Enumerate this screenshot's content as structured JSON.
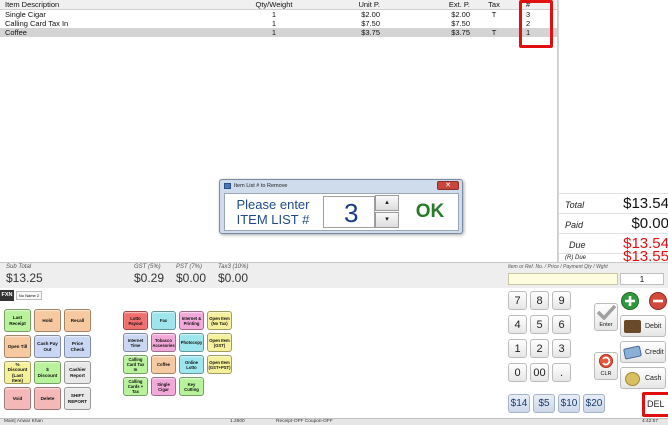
{
  "items_table": {
    "headers": {
      "description": "Item Description",
      "qty": "Qty/Weight",
      "unit_price": "Unit P.",
      "ext_price": "Ext. P.",
      "tax": "Tax",
      "list_num": "#"
    },
    "rows": [
      {
        "description": "Single Cigar",
        "qty": "1",
        "unit_price": "$2.00",
        "ext_price": "$2.00",
        "tax": "T",
        "list_num": "3"
      },
      {
        "description": "Calling Card Tax In",
        "qty": "1",
        "unit_price": "$7.50",
        "ext_price": "$7.50",
        "tax": "",
        "list_num": "2"
      },
      {
        "description": "Coffee",
        "qty": "1",
        "unit_price": "$3.75",
        "ext_price": "$3.75",
        "tax": "T",
        "list_num": "1"
      }
    ]
  },
  "totals": {
    "total_label": "Total",
    "total_value": "$13.54",
    "paid_label": "Paid",
    "paid_value": "$0.00",
    "due_label": "Due",
    "due_value": "$13.54",
    "rdue_label": "(R) Due",
    "rdue_value": "$13.55"
  },
  "dialog": {
    "title": "Item List # to Remove",
    "prompt_line1": "Please enter",
    "prompt_line2": "ITEM LIST #",
    "value": "3",
    "up_icon": "up-arrow",
    "down_icon": "down-arrow",
    "ok_label": "OK"
  },
  "subtotal_bar": {
    "subtotal_label": "Sub Total",
    "subtotal_value": "$13.25",
    "gst_label": "GST (5%)",
    "gst_value": "$0.29",
    "pst_label": "PST (7%)",
    "pst_value": "$0.00",
    "tax3_label": "Tax3 (10%)",
    "tax3_value": "$0.00",
    "ref_label": "Item or Ref. No. / Price / Payment   Qty / Wght",
    "qty_value": "1"
  },
  "fxn_tab": {
    "label": "FXN",
    "name_box": "No Name 2"
  },
  "buttons": {
    "last_receipt": "Last Receipt",
    "hold": "Hold",
    "recall": "Recall",
    "open_till": "Open Till",
    "cash_pay_out": "Cash Pay Out",
    "price_check": "Price Check",
    "pct_discount": "% Discount (Last Item)",
    "dollar_discount": "$ Discount",
    "cashier_report": "Cashier Report",
    "void": "Void",
    "delete": "Delete",
    "shift_report": "SHIFT REPORT",
    "lotto_payout": "Lotto Payout",
    "fax": "Fax",
    "internet_printing": "Internet & Printing",
    "open_item_notax": "Open Item (No Tax)",
    "internet_time": "Internet Time",
    "tobacco_acc": "Tobacco Accesories",
    "photocopy": "Photocopy",
    "open_item_gst": "Open Item (GST)",
    "calling_card_tax_in": "Calling Card Tax In",
    "coffee": "Coffee",
    "online_lotto": "Online Lotto",
    "open_item_gstpst": "Open Item (GST+PST)",
    "calling_cards_tax": "Calling Cards + Tax",
    "single_cigar": "Single Cigar",
    "key_cutting": "Key Cutting"
  },
  "keypad": {
    "digits": [
      "7",
      "8",
      "9",
      "4",
      "5",
      "6",
      "1",
      "2",
      "3",
      "0",
      "00",
      "."
    ],
    "enter_label": "Enter",
    "clr_label": "CLR",
    "cash_amounts": [
      "$14",
      "$5",
      "$10",
      "$20"
    ],
    "debit_label": "Debit",
    "credit_label": "Credit",
    "cash_label": "Cash",
    "del_label": "DEL"
  },
  "status_bar": {
    "user": "Main| Anwar Khan",
    "version": "1.2600",
    "receipt_status": "Receipt-OFF  Coupon-OFF",
    "time": "4:42:57"
  },
  "colors": {
    "due_red": "#e01010",
    "highlight_red": "#e01010",
    "orange_btn": "#f7c9a0",
    "pink_btn": "#f5b8b8",
    "blue_btn": "#c9d7f3",
    "yellow_btn": "#f5f09a",
    "green_btn": "#b8f29a",
    "magenta_btn": "#f2a8d8",
    "red_btn": "#f07070",
    "cyan_btn": "#9de6ee"
  }
}
